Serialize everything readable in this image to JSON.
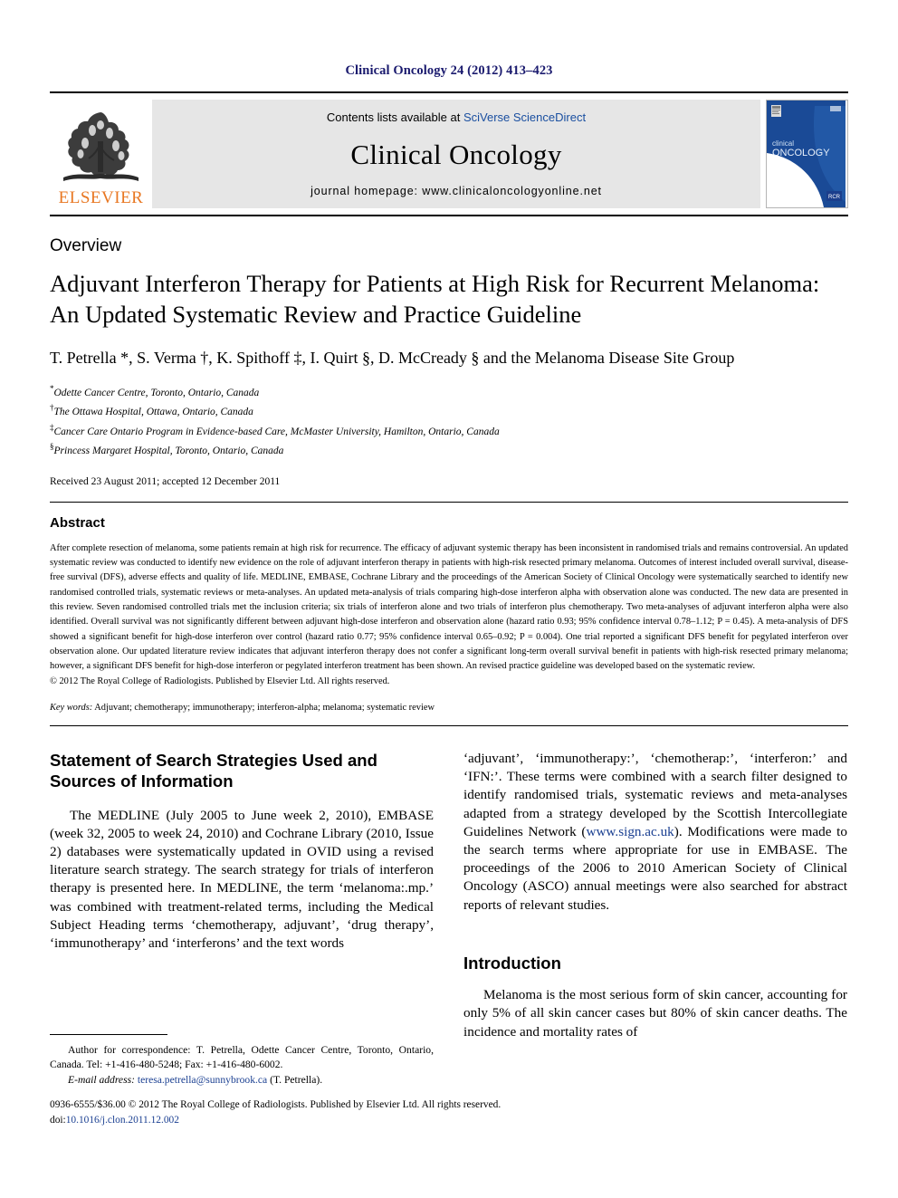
{
  "running_head": "Clinical Oncology 24 (2012) 413–423",
  "banner": {
    "publisher_logo_text": "ELSEVIER",
    "contents_prefix": "Contents lists available at ",
    "contents_link": "SciVerse ScienceDirect",
    "journal_name": "Clinical Oncology",
    "homepage": "journal homepage: www.clinicaloncologyonline.net",
    "cover": {
      "line1": "clinical",
      "line2": "ONCOLOGY",
      "badge": "RCR"
    }
  },
  "article": {
    "type_label": "Overview",
    "title": "Adjuvant Interferon Therapy for Patients at High Risk for Recurrent Melanoma: An Updated Systematic Review and Practice Guideline",
    "authors": "T. Petrella *, S. Verma †, K. Spithoff ‡, I. Quirt §, D. McCready § and the Melanoma Disease Site Group",
    "affiliations": [
      {
        "marker": "*",
        "text": "Odette Cancer Centre, Toronto, Ontario, Canada"
      },
      {
        "marker": "†",
        "text": "The Ottawa Hospital, Ottawa, Ontario, Canada"
      },
      {
        "marker": "‡",
        "text": "Cancer Care Ontario Program in Evidence-based Care, McMaster University, Hamilton, Ontario, Canada"
      },
      {
        "marker": "§",
        "text": "Princess Margaret Hospital, Toronto, Ontario, Canada"
      }
    ],
    "history": "Received 23 August 2011; accepted 12 December 2011"
  },
  "abstract": {
    "heading": "Abstract",
    "text": "After complete resection of melanoma, some patients remain at high risk for recurrence. The efficacy of adjuvant systemic therapy has been inconsistent in randomised trials and remains controversial. An updated systematic review was conducted to identify new evidence on the role of adjuvant interferon therapy in patients with high-risk resected primary melanoma. Outcomes of interest included overall survival, disease-free survival (DFS), adverse effects and quality of life. MEDLINE, EMBASE, Cochrane Library and the proceedings of the American Society of Clinical Oncology were systematically searched to identify new randomised controlled trials, systematic reviews or meta-analyses. An updated meta-analysis of trials comparing high-dose interferon alpha with observation alone was conducted. The new data are presented in this review. Seven randomised controlled trials met the inclusion criteria; six trials of interferon alone and two trials of interferon plus chemotherapy. Two meta-analyses of adjuvant interferon alpha were also identified. Overall survival was not significantly different between adjuvant high-dose interferon and observation alone (hazard ratio 0.93; 95% confidence interval 0.78–1.12; P = 0.45). A meta-analysis of DFS showed a significant benefit for high-dose interferon over control (hazard ratio 0.77; 95% confidence interval 0.65–0.92; P = 0.004). One trial reported a significant DFS benefit for pegylated interferon over observation alone. Our updated literature review indicates that adjuvant interferon therapy does not confer a significant long-term overall survival benefit in patients with high-risk resected primary melanoma; however, a significant DFS benefit for high-dose interferon or pegylated interferon treatment has been shown. An revised practice guideline was developed based on the systematic review.",
    "copyright": "© 2012 The Royal College of Radiologists. Published by Elsevier Ltd. All rights reserved.",
    "keywords_label": "Key words:",
    "keywords_text": " Adjuvant; chemotherapy; immunotherapy; interferon-alpha; melanoma; systematic review"
  },
  "body": {
    "left": {
      "heading": "Statement of Search Strategies Used and Sources of Information",
      "paragraph_1": "The MEDLINE (July 2005 to June week 2, 2010), EMBASE (week 32, 2005 to week 24, 2010) and Cochrane Library (2010, Issue 2) databases were systematically updated in OVID using a revised literature search strategy. The search strategy for trials of interferon therapy is presented here. In MEDLINE, the term ‘melanoma:.mp.’ was combined with treatment-related terms, including the Medical Subject Heading terms ‘chemotherapy, adjuvant’, ‘drug therapy’, ‘immunotherapy’ and ‘interferons’ and the text words"
    },
    "right": {
      "paragraph_continued_a": "‘adjuvant’, ‘immunotherapy:’, ‘chemotherap:’, ‘interferon:’ and ‘IFN:’. These terms were combined with a search filter designed to identify randomised trials, systematic reviews and meta-analyses adapted from a strategy developed by the Scottish Intercollegiate Guidelines Network (",
      "sign_link": "www.sign.ac.uk",
      "paragraph_continued_b": "). Modifications were made to the search terms where appropriate for use in EMBASE. The proceedings of the 2006 to 2010 American Society of Clinical Oncology (ASCO) annual meetings were also searched for abstract reports of relevant studies.",
      "heading": "Introduction",
      "paragraph_intro": "Melanoma is the most serious form of skin cancer, accounting for only 5% of all skin cancer cases but 80% of skin cancer deaths. The incidence and mortality rates of"
    }
  },
  "footnote": {
    "correspondence": "Author for correspondence: T. Petrella, Odette Cancer Centre, Toronto, Ontario, Canada. Tel: +1-416-480-5248; Fax: +1-416-480-6002.",
    "email_label": "E-mail address:",
    "email": "teresa.petrella@sunnybrook.ca",
    "email_suffix": " (T. Petrella)."
  },
  "footer": {
    "issn_line": "0936-6555/$36.00 © 2012 The Royal College of Radiologists. Published by Elsevier Ltd. All rights reserved.",
    "doi_label": "doi:",
    "doi": "10.1016/j.clon.2011.12.002"
  },
  "colors": {
    "running_head": "#1a1a6e",
    "link": "#1a3f91",
    "elsevier_orange": "#E87722",
    "banner_bg": "#e6e6e6",
    "cover_blue": "#1a4a96"
  }
}
